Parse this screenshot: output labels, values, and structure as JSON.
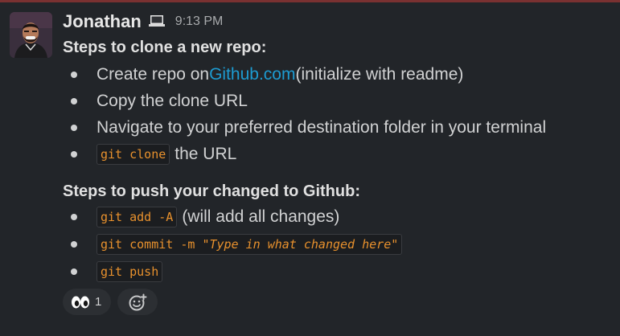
{
  "message": {
    "author": "Jonathan",
    "time": "9:13 PM",
    "status_icon": "laptop-icon",
    "avatar_icon": "user-avatar"
  },
  "sections": [
    {
      "title": "Steps to clone a new repo:",
      "items": [
        {
          "before": "Create repo on ",
          "link": "Github.com",
          "after": " (initialize with readme)"
        },
        {
          "text": "Copy the clone URL"
        },
        {
          "text": "Navigate to your preferred destination folder in your terminal"
        },
        {
          "code": "git clone",
          "after": " the URL"
        }
      ]
    },
    {
      "title": "Steps to push your changed to Github:",
      "items": [
        {
          "code": "git add -A",
          "after": " (will add all changes)"
        },
        {
          "code_prefix": "git commit -m ",
          "code_quote_open": "\"",
          "code_italic": "Type in what changed here",
          "code_quote_close": "\""
        },
        {
          "code": "git push"
        }
      ]
    }
  ],
  "reactions": [
    {
      "emoji": "eyes-emoji",
      "count": "1"
    },
    {
      "emoji": "add-reaction-icon",
      "count": ""
    }
  ],
  "colors": {
    "background": "#222529",
    "link": "#1d9bd1",
    "code": "#e8912d",
    "top_border": "#7a3131"
  }
}
